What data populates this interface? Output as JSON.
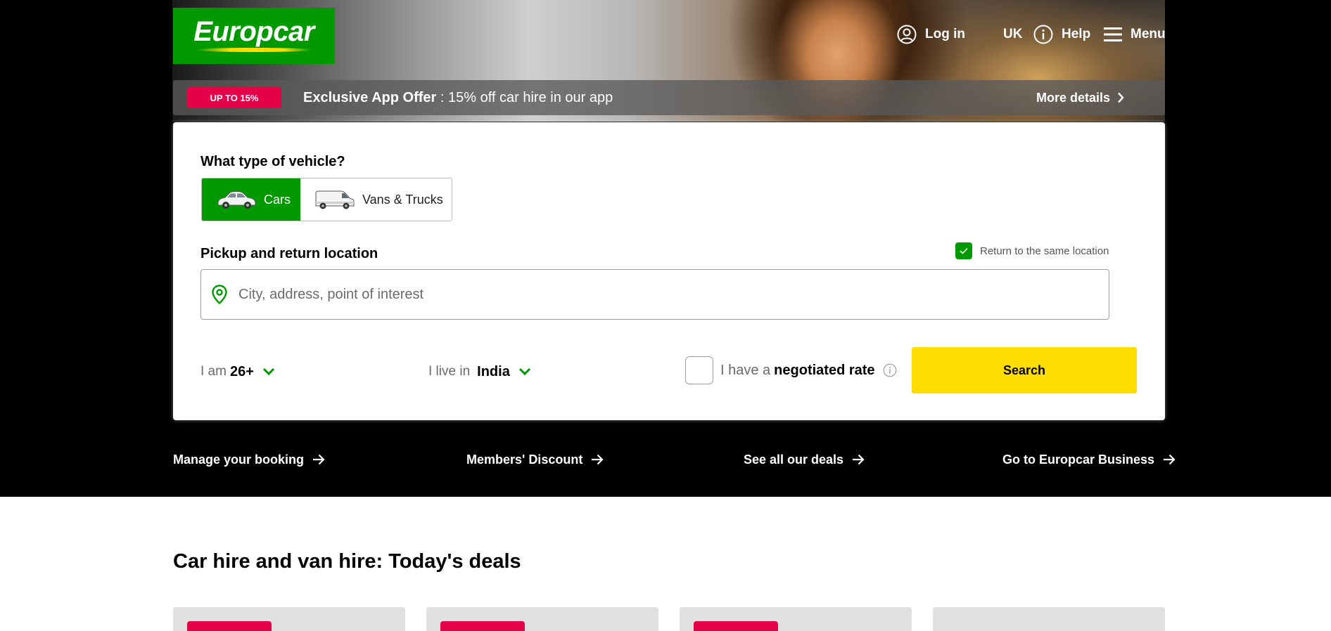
{
  "brand": {
    "logo_text": "Europcar",
    "color": "#009900",
    "accent": "#ffdd00"
  },
  "topnav": {
    "login": "Log in",
    "region": "UK",
    "help": "Help",
    "menu": "Menu"
  },
  "offer": {
    "badge": "UP TO 15%",
    "title": "Exclusive App Offer",
    "text": " : 15% off car hire in our app",
    "more": "More details",
    "badge_color": "#e5004a"
  },
  "search": {
    "vehicle_question": "What type of vehicle?",
    "vehicle_types": [
      {
        "label": "Cars",
        "selected": true
      },
      {
        "label": "Vans & Trucks",
        "selected": false
      }
    ],
    "location_label": "Pickup and return location",
    "same_location_label": "Return to the same location",
    "same_location_checked": true,
    "location_placeholder": "City, address, point of interest",
    "age_prefix": "I am",
    "age_value": "26+",
    "country_prefix": "I live in",
    "country_value": "India",
    "negotiated_prefix": "I have a",
    "negotiated_bold": "negotiated rate",
    "negotiated_checked": false,
    "search_button": "Search"
  },
  "quick_links": [
    "Manage your booking",
    "Members' Discount",
    "See all our deals",
    "Go to Europcar Business"
  ],
  "deals": {
    "title": "Car hire and van hire: Today's deals"
  }
}
